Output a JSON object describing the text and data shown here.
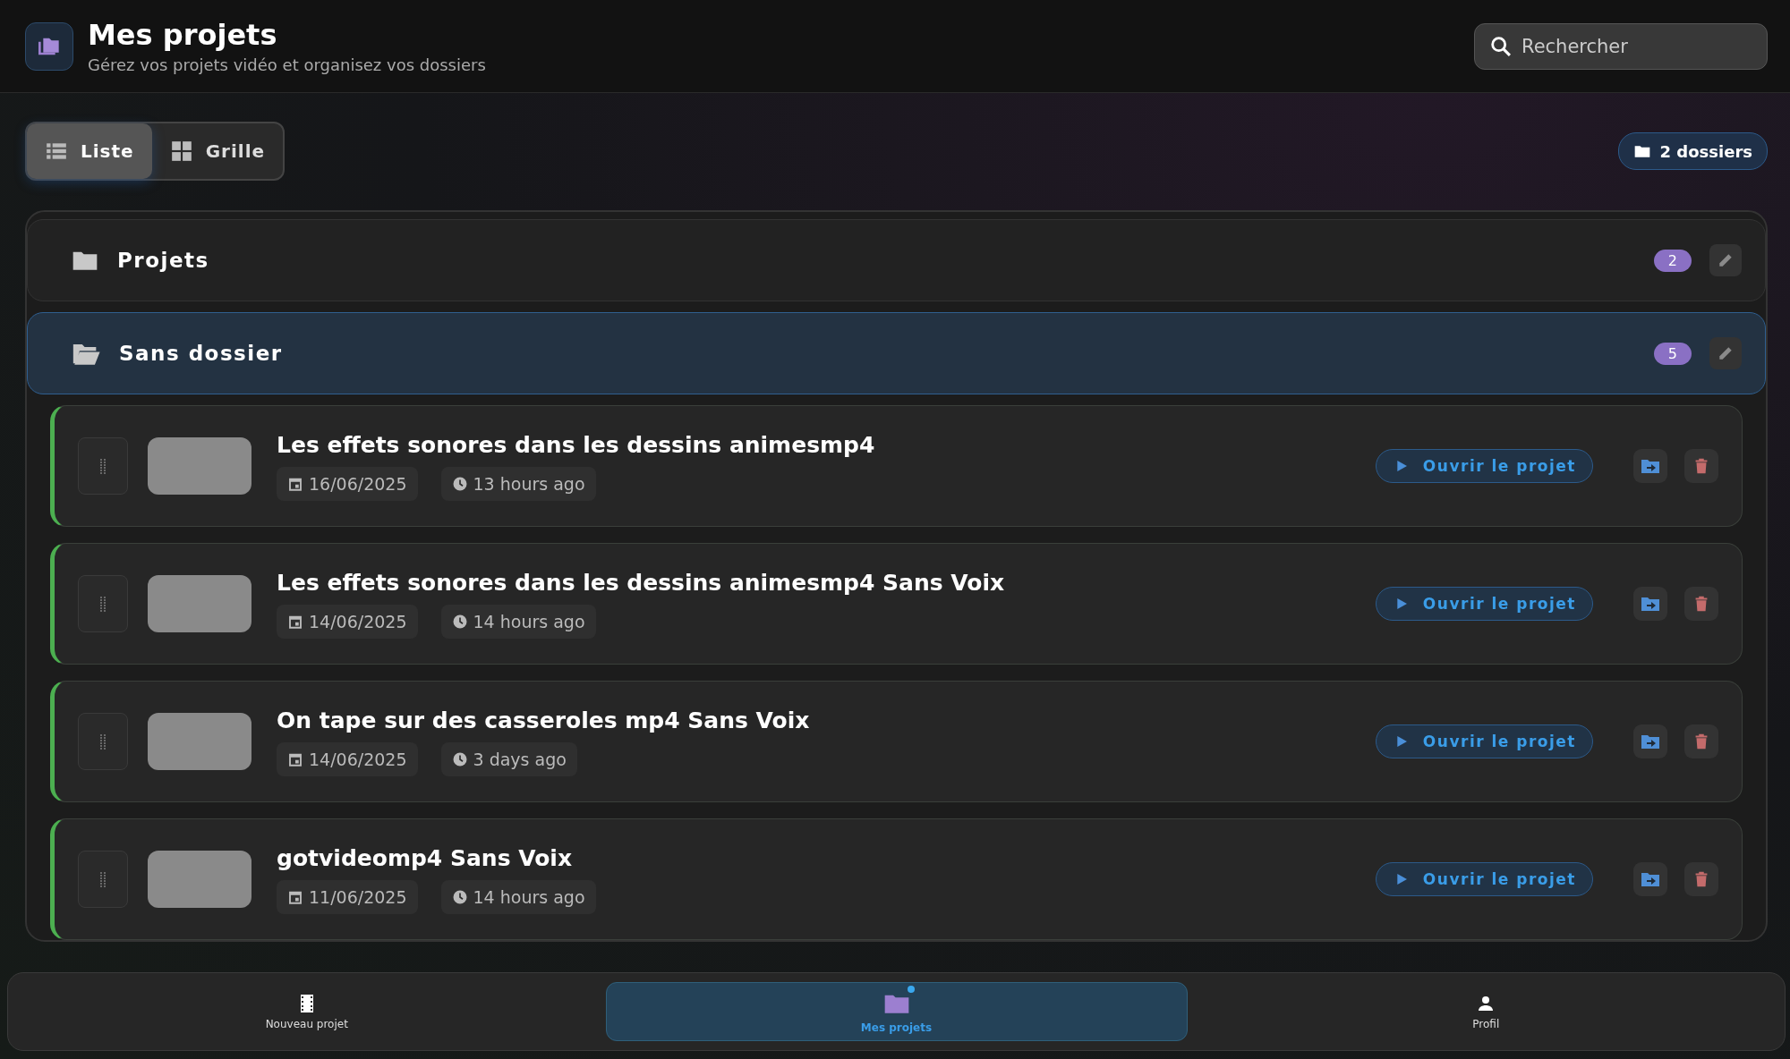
{
  "header": {
    "title": "Mes projets",
    "subtitle": "Gérez vos projets vidéo et organisez vos dossiers",
    "search": {
      "placeholder": "Rechercher"
    }
  },
  "view_toggle": [
    {
      "label": "Liste",
      "kind": "list",
      "selected": true
    },
    {
      "label": "Grille",
      "kind": "grid",
      "selected": false
    }
  ],
  "folder_count": "2 dossiers",
  "folders": [
    {
      "name": "Projets",
      "count": "2",
      "expanded": false
    },
    {
      "name": "Sans dossier",
      "count": "5",
      "expanded": true
    }
  ],
  "projects": [
    {
      "title": "Les effets sonores dans les dessins animesmp4",
      "date": "16/06/2025",
      "age": "13 hours ago",
      "open_label": "Ouvrir le projet"
    },
    {
      "title": "Les effets sonores dans les dessins animesmp4 Sans Voix",
      "date": "14/06/2025",
      "age": "14 hours ago",
      "open_label": "Ouvrir le projet"
    },
    {
      "title": "On tape sur des casseroles mp4 Sans Voix",
      "date": "14/06/2025",
      "age": "3 days ago",
      "open_label": "Ouvrir le projet"
    },
    {
      "title": "gotvideomp4 Sans Voix",
      "date": "11/06/2025",
      "age": "14 hours ago",
      "open_label": "Ouvrir le projet"
    }
  ],
  "bottom_nav": [
    {
      "label": "Nouveau projet",
      "kind": "film",
      "selected": false
    },
    {
      "label": "Mes projets",
      "kind": "folder",
      "selected": true
    },
    {
      "label": "Profil",
      "kind": "person",
      "selected": false
    }
  ]
}
